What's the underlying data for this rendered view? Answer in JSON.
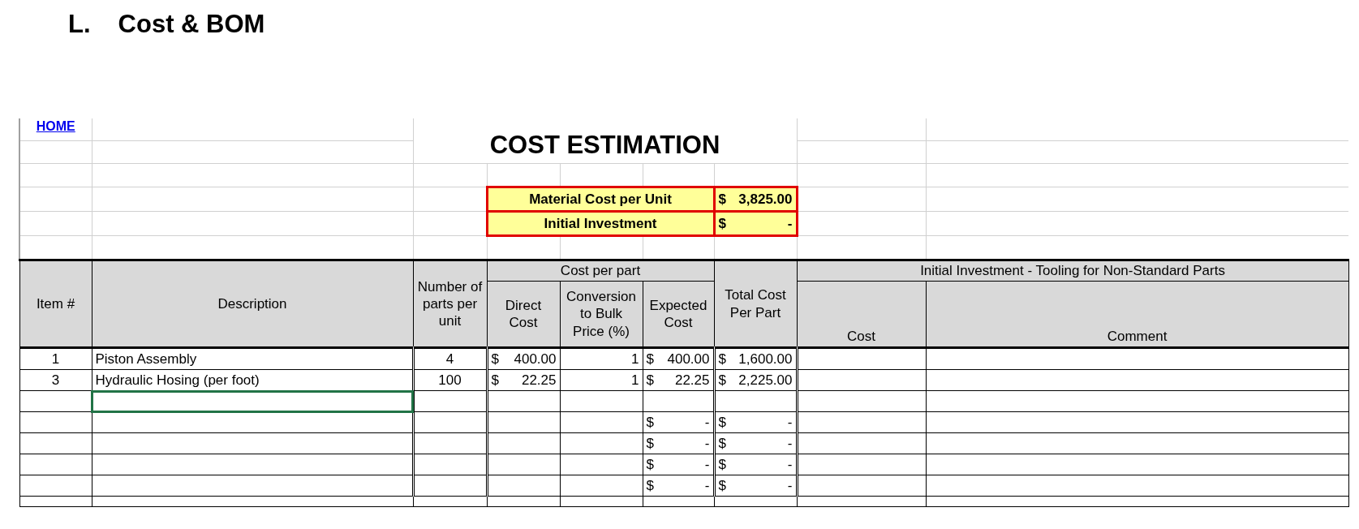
{
  "page_heading": {
    "marker": "L.",
    "title": "Cost & BOM"
  },
  "sheet": {
    "home_link": "HOME",
    "title": "COST ESTIMATION",
    "summary": [
      {
        "label": "Material Cost per Unit",
        "symbol": "$",
        "amount": "3,825.00"
      },
      {
        "label": "Initial Investment",
        "symbol": "$",
        "amount": "-"
      }
    ],
    "header": {
      "item": "Item #",
      "description": "Description",
      "parts": "Number of parts per unit",
      "cost_per_part": "Cost per part",
      "direct": "Direct Cost",
      "conversion": "Conversion to Bulk Price (%)",
      "expected": "Expected Cost",
      "total": "Total Cost Per Part",
      "investment": "Initial Investment - Tooling for Non-Standard Parts",
      "cost": "Cost",
      "comment": "Comment"
    },
    "rows": [
      {
        "item": "1",
        "description": "Piston Assembly",
        "parts": "4",
        "direct": {
          "symbol": "$",
          "amount": "400.00"
        },
        "conversion": "1",
        "expected": {
          "symbol": "$",
          "amount": "400.00"
        },
        "total": {
          "symbol": "$",
          "amount": "1,600.00"
        },
        "selected": false
      },
      {
        "item": "3",
        "description": "Hydraulic Hosing (per foot)",
        "parts": "100",
        "direct": {
          "symbol": "$",
          "amount": "22.25"
        },
        "conversion": "1",
        "expected": {
          "symbol": "$",
          "amount": "22.25"
        },
        "total": {
          "symbol": "$",
          "amount": "2,225.00"
        },
        "selected": false
      },
      {
        "selected": true
      },
      {
        "expected": {
          "symbol": "$",
          "amount": "-"
        },
        "total": {
          "symbol": "$",
          "amount": "-"
        },
        "selected": false
      },
      {
        "expected": {
          "symbol": "$",
          "amount": "-"
        },
        "total": {
          "symbol": "$",
          "amount": "-"
        },
        "selected": false
      },
      {
        "expected": {
          "symbol": "$",
          "amount": "-"
        },
        "total": {
          "symbol": "$",
          "amount": "-"
        },
        "selected": false
      },
      {
        "expected": {
          "symbol": "$",
          "amount": "-"
        },
        "total": {
          "symbol": "$",
          "amount": "-"
        },
        "selected": false
      }
    ]
  }
}
